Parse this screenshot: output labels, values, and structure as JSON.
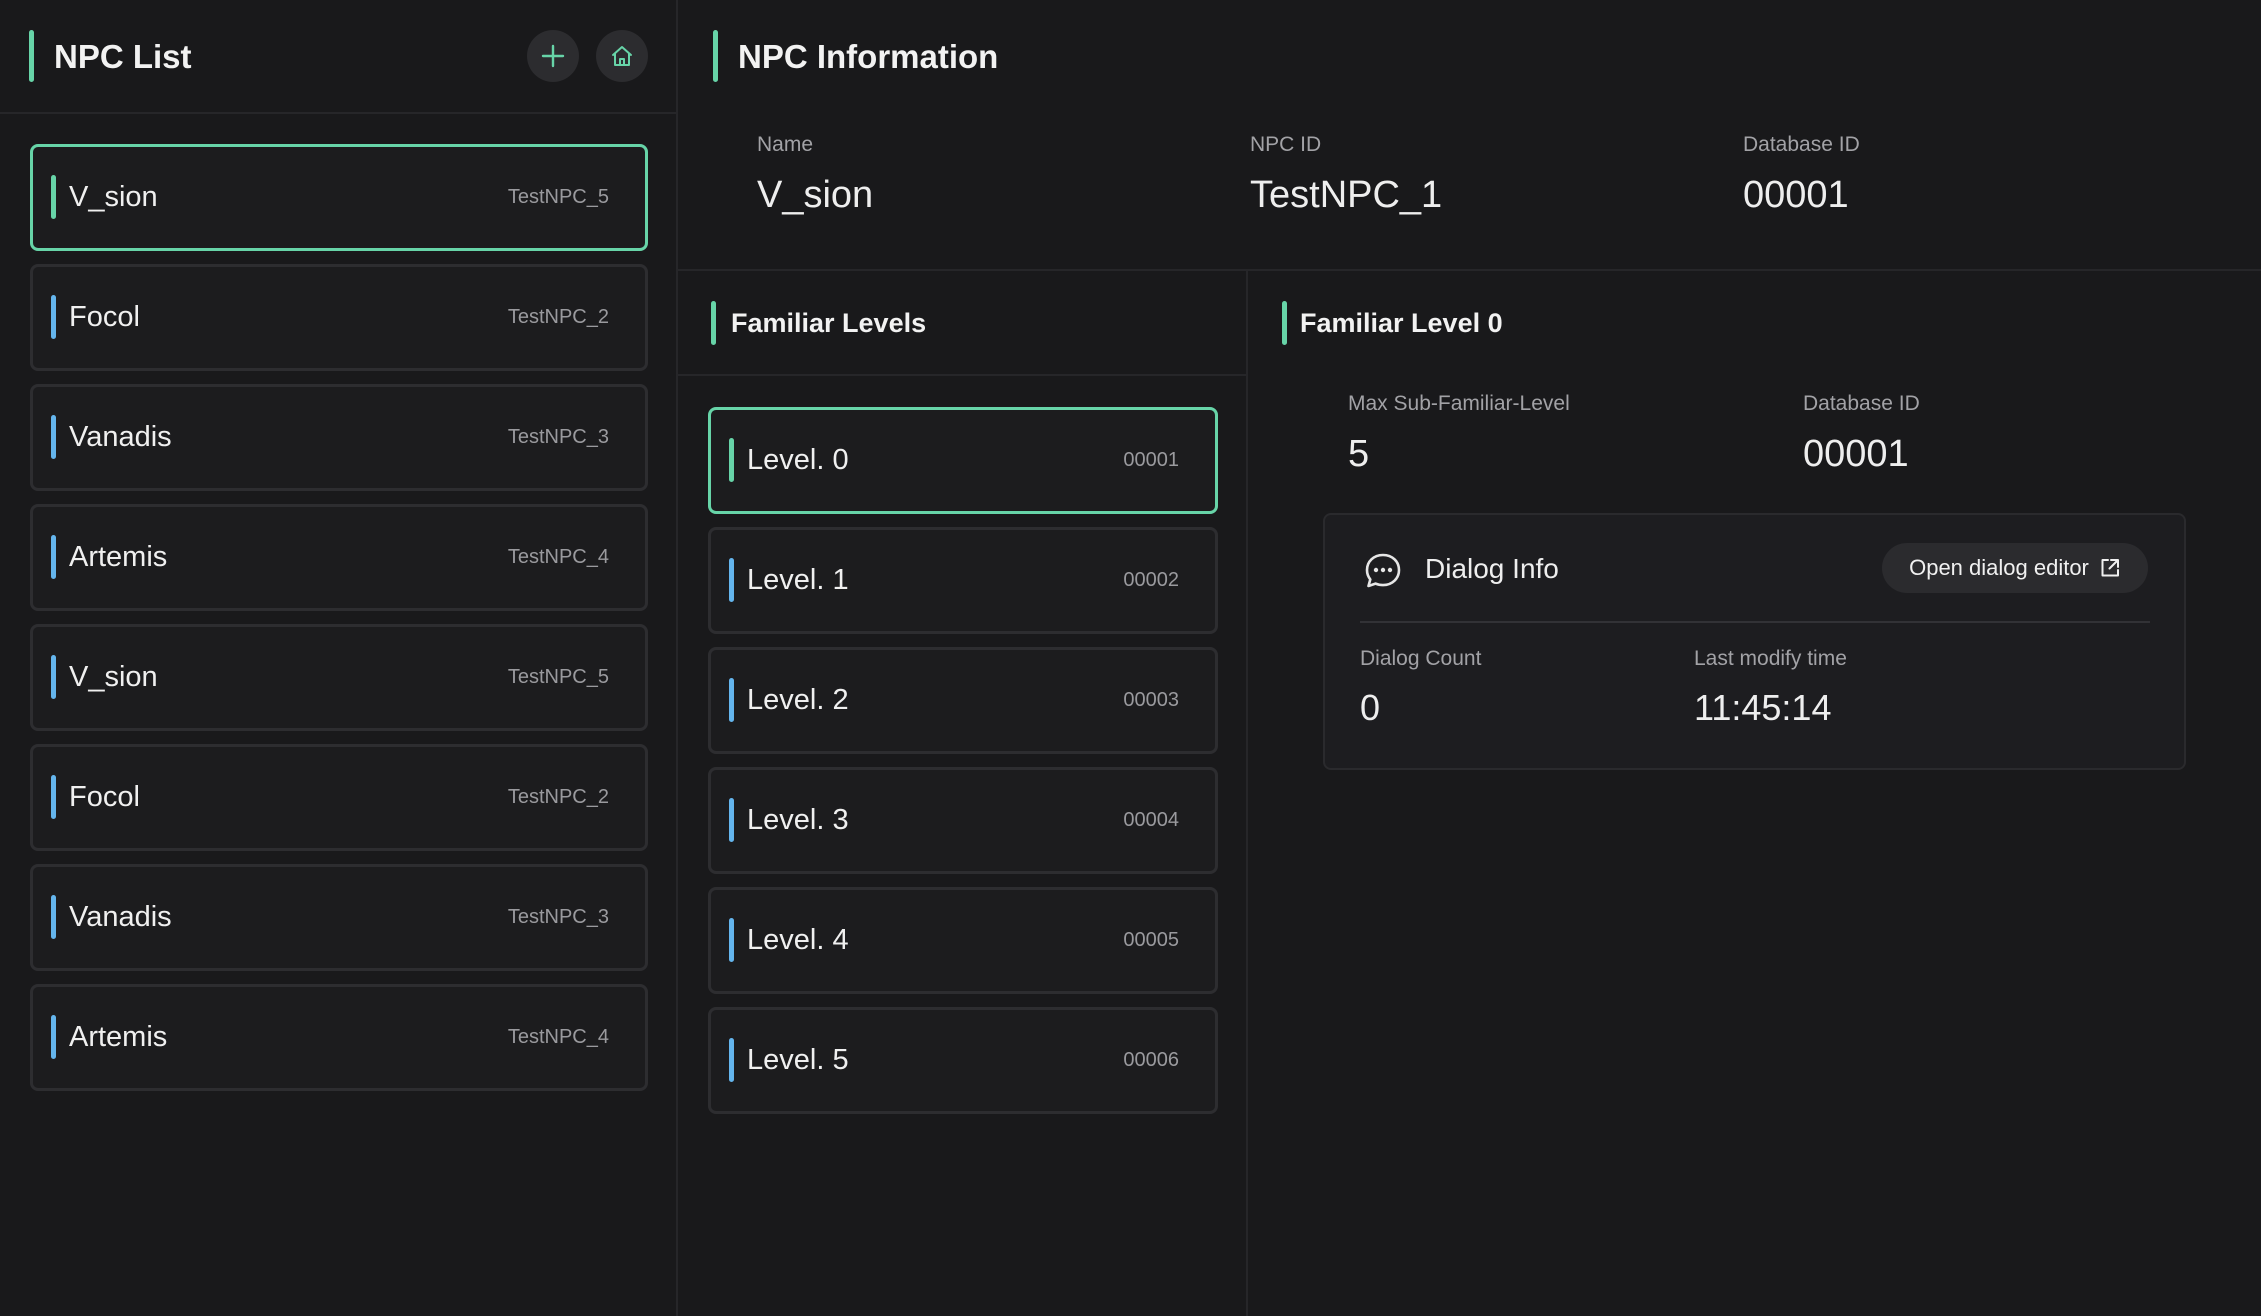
{
  "npc_list": {
    "title": "NPC List",
    "add_icon": "plus-icon",
    "home_icon": "home-icon",
    "items": [
      {
        "name": "V_sion",
        "id": "TestNPC_5",
        "selected": true
      },
      {
        "name": "Focol",
        "id": "TestNPC_2",
        "selected": false
      },
      {
        "name": "Vanadis",
        "id": "TestNPC_3",
        "selected": false
      },
      {
        "name": "Artemis",
        "id": "TestNPC_4",
        "selected": false
      },
      {
        "name": "V_sion",
        "id": "TestNPC_5",
        "selected": false
      },
      {
        "name": "Focol",
        "id": "TestNPC_2",
        "selected": false
      },
      {
        "name": "Vanadis",
        "id": "TestNPC_3",
        "selected": false
      },
      {
        "name": "Artemis",
        "id": "TestNPC_4",
        "selected": false
      }
    ]
  },
  "npc_info": {
    "title": "NPC Information",
    "name_label": "Name",
    "name_value": "V_sion",
    "npc_id_label": "NPC ID",
    "npc_id_value": "TestNPC_1",
    "db_id_label": "Database ID",
    "db_id_value": "00001"
  },
  "familiar_levels": {
    "title": "Familiar Levels",
    "items": [
      {
        "label": "Level. 0",
        "id": "00001",
        "selected": true
      },
      {
        "label": "Level. 1",
        "id": "00002",
        "selected": false
      },
      {
        "label": "Level. 2",
        "id": "00003",
        "selected": false
      },
      {
        "label": "Level. 3",
        "id": "00004",
        "selected": false
      },
      {
        "label": "Level. 4",
        "id": "00005",
        "selected": false
      },
      {
        "label": "Level. 5",
        "id": "00006",
        "selected": false
      }
    ]
  },
  "familiar_level_detail": {
    "title": "Familiar Level 0",
    "max_sub_label": "Max Sub-Familiar-Level",
    "max_sub_value": "5",
    "db_id_label": "Database ID",
    "db_id_value": "00001",
    "dialog": {
      "icon": "chat-bubble-icon",
      "title": "Dialog Info",
      "open_button_label": "Open dialog editor",
      "open_button_icon": "external-link-icon",
      "count_label": "Dialog Count",
      "count_value": "0",
      "modify_label": "Last modify time",
      "modify_value": "11:45:14"
    }
  },
  "colors": {
    "accent_green": "#67d4a8",
    "accent_blue": "#64b5ed",
    "background": "#19191b"
  }
}
